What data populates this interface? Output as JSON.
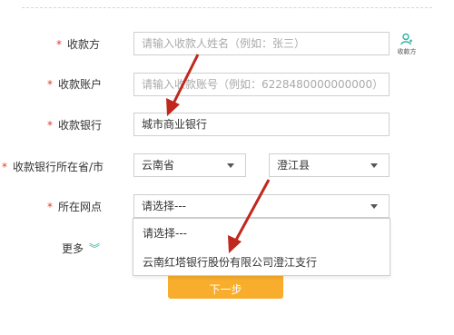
{
  "form": {
    "payee": {
      "label": "收款方",
      "placeholder": "请输入收款人姓名（例如：张三）"
    },
    "account": {
      "label": "收款账户",
      "placeholder": "请输入收款账号（例如：6228480000000000）"
    },
    "bank": {
      "label": "收款银行",
      "value": "城市商业银行"
    },
    "region": {
      "label": "收款银行所在省/市",
      "province": "云南省",
      "county": "澄江县"
    },
    "branch": {
      "label": "所在网点",
      "value": "请选择---"
    },
    "required_mark": "*"
  },
  "payee_icon": {
    "icon": "person-icon",
    "label": "收款方"
  },
  "dropdown": {
    "options": [
      "请选择---",
      "云南红塔银行股份有限公司澄江支行"
    ]
  },
  "more": {
    "label": "更多",
    "icon": "chevron-double-down-icon"
  },
  "next_button": {
    "label": "下一步"
  },
  "colors": {
    "accent_orange": "#f8ad2d",
    "required_red": "#e23a2e",
    "arrow_red": "#c0281d",
    "teal": "#2bb3a3"
  }
}
